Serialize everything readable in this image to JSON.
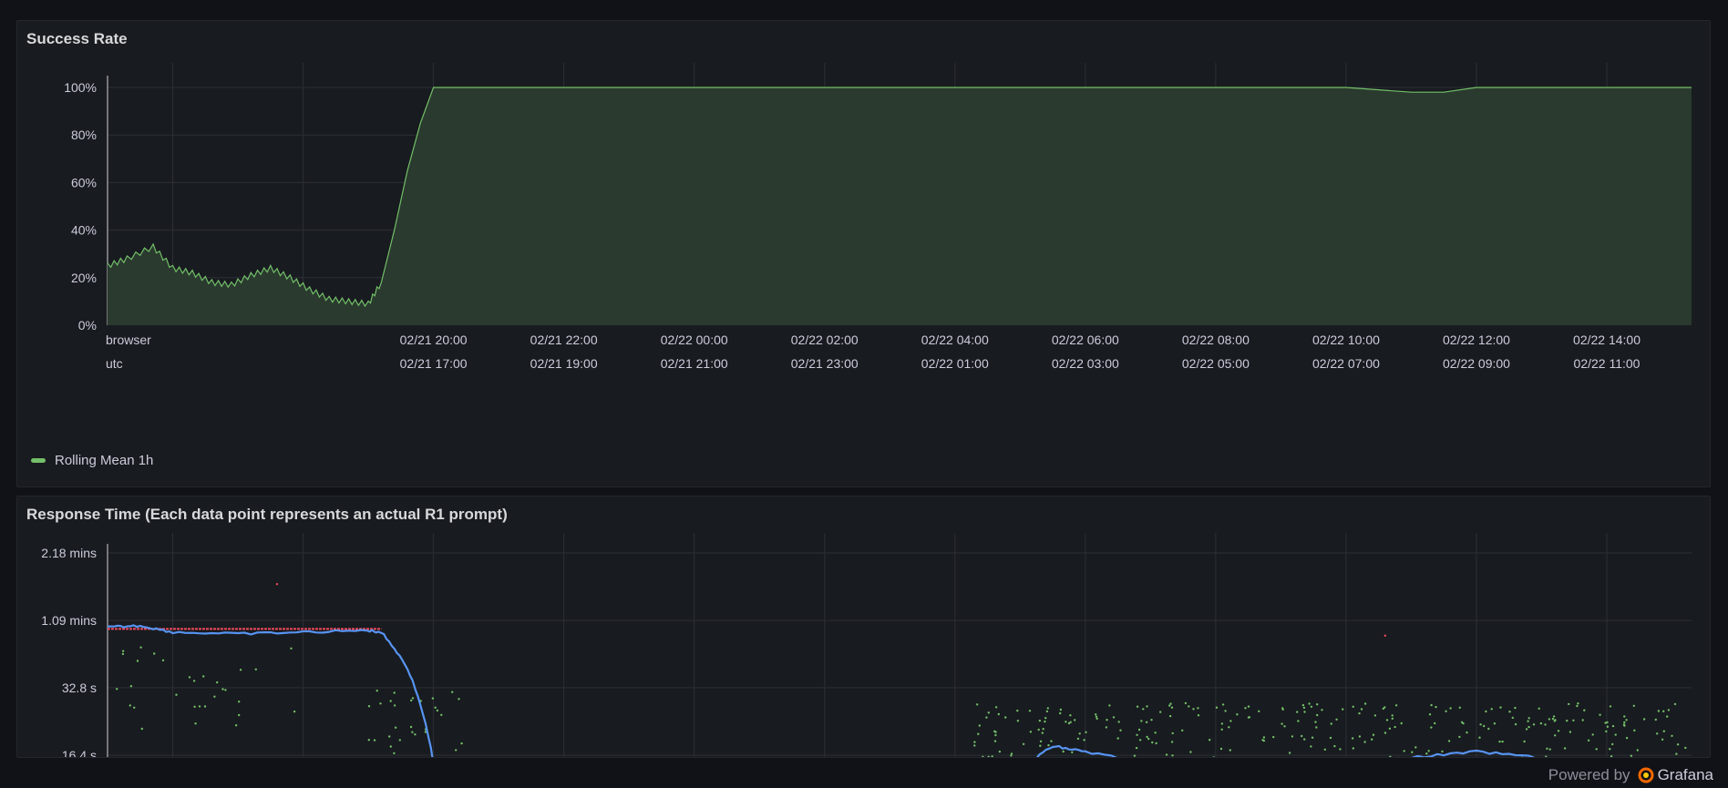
{
  "panels": {
    "success": {
      "title": "Success Rate",
      "legend_label": "Rolling Mean 1h",
      "row_labels": [
        "browser",
        "utc"
      ]
    },
    "response": {
      "title": "Response Time (Each data point represents an actual R1 prompt)"
    }
  },
  "footer": {
    "powered_by": "Powered by",
    "brand": "Grafana"
  },
  "colors": {
    "background": "#111217",
    "panel": "#181b1f",
    "success_line": "#73bf69",
    "success_fill": "#2a3a2e",
    "scatter_green": "#73bf69",
    "scatter_red": "#f2495c",
    "mean_blue": "#5794f2",
    "grid": "#2c2f36",
    "text": "#ccccdc"
  },
  "chart_data": [
    {
      "type": "area",
      "title": "Success Rate",
      "xlabel": "",
      "ylabel": "",
      "ylim": [
        0,
        100
      ],
      "y_ticks": [
        "0%",
        "20%",
        "40%",
        "60%",
        "80%",
        "100%"
      ],
      "x_ticks_browser": [
        "02/21 20:00",
        "02/21 22:00",
        "02/22 00:00",
        "02/22 02:00",
        "02/22 04:00",
        "02/22 06:00",
        "02/22 08:00",
        "02/22 10:00",
        "02/22 12:00",
        "02/22 14:00"
      ],
      "x_ticks_utc": [
        "02/21 17:00",
        "02/21 19:00",
        "02/21 21:00",
        "02/21 23:00",
        "02/22 01:00",
        "02/22 03:00",
        "02/22 05:00",
        "02/22 07:00",
        "02/22 09:00",
        "02/22 11:00"
      ],
      "x_range_hours": [
        15,
        39.3
      ],
      "series": [
        {
          "name": "Rolling Mean 1h",
          "x": [
            15.0,
            15.3,
            15.7,
            16.0,
            16.3,
            16.6,
            16.9,
            17.2,
            17.5,
            17.8,
            18.1,
            18.4,
            18.7,
            19.0,
            19.2,
            19.4,
            19.6,
            19.8,
            20.0,
            21.0,
            22.0,
            24.0,
            26.0,
            28.0,
            30.0,
            32.0,
            34.0,
            35.0,
            35.5,
            36.0,
            37.0,
            38.0,
            39.3
          ],
          "y": [
            25,
            28,
            33,
            24,
            22,
            18,
            17,
            21,
            24,
            20,
            15,
            11,
            10,
            9,
            18,
            40,
            65,
            85,
            100,
            100,
            100,
            100,
            100,
            100,
            100,
            100,
            100,
            98,
            98,
            100,
            100,
            100,
            100
          ]
        }
      ],
      "legend": "bottom-left",
      "grid": true
    },
    {
      "type": "scatter",
      "title": "Response Time (Each data point represents an actual R1 prompt)",
      "xlabel": "",
      "ylabel": "",
      "y_scale": "log",
      "y_ticks": [
        "2.18 mins",
        "1.09 mins",
        "32.8 s",
        "16.4 s"
      ],
      "y_tick_seconds": [
        130.8,
        65.4,
        32.8,
        16.4
      ],
      "x_range_hours": [
        15,
        39.3
      ],
      "mean_series": {
        "x": [
          15.0,
          15.5,
          16.0,
          17.0,
          18.0,
          19.0,
          19.2,
          19.6,
          20.0,
          20.3,
          28.5,
          29.0,
          29.5,
          30.0,
          31.0,
          32.0,
          33.0,
          34.0,
          35.0,
          36.0,
          37.0,
          38.0,
          39.3
        ],
        "y": [
          61,
          62,
          58,
          57,
          58,
          59,
          58,
          40,
          15,
          12,
          10,
          14,
          18,
          17,
          15,
          13,
          15,
          15,
          16,
          17,
          16,
          15,
          14
        ]
      },
      "red_series": {
        "x": [
          15.0,
          16.0,
          17.0,
          18.0,
          19.2,
          17.6,
          34.6
        ],
        "y": [
          60,
          60,
          60,
          60,
          60,
          95,
          56
        ]
      }
    }
  ]
}
